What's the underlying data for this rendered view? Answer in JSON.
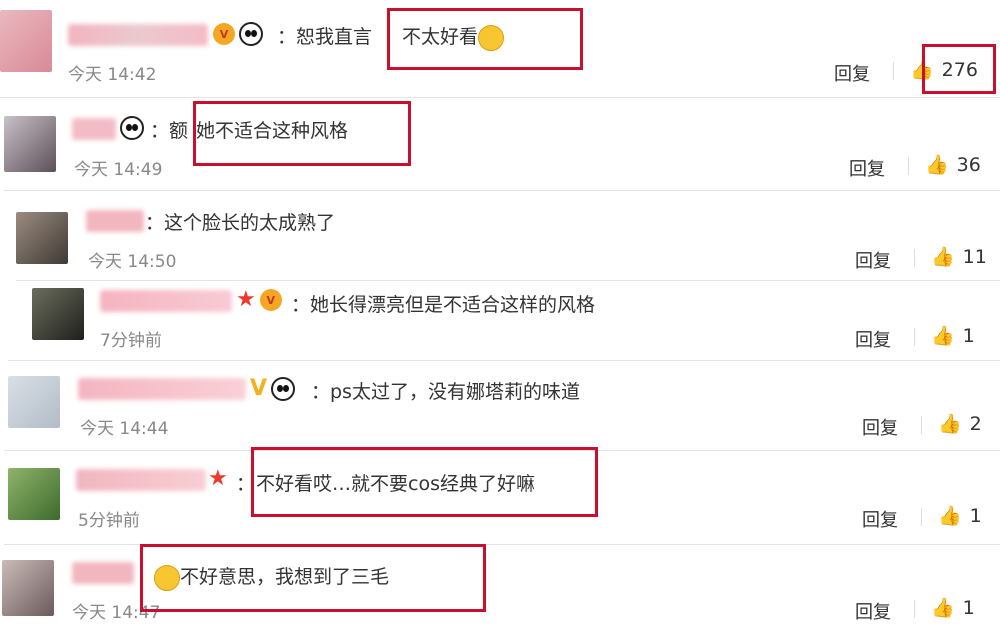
{
  "comments": [
    {
      "username_blurred": "用户昵称",
      "text": "：恕我直言",
      "quote": "不太好看",
      "time": "今天 14:42",
      "reply": "回复",
      "likes": "276"
    },
    {
      "text": "：额",
      "quote": "她不适合这种风格",
      "time": "今天 14:49",
      "reply": "回复",
      "likes": "36"
    },
    {
      "text": "：这个脸长的太成熟了",
      "time": "今天 14:50",
      "reply": "回复",
      "likes": "11"
    },
    {
      "username_blurred": "BABY CHUPIN",
      "text": "：她长得漂亮但是不适合这样的风格",
      "time": "7分钟前",
      "reply": "回复",
      "likes": "1"
    },
    {
      "text": "：ps太过了，没有娜塔莉的味道",
      "time": "今天 14:44",
      "reply": "回复",
      "likes": "2"
    },
    {
      "text": "：",
      "quote": "不好看哎…就不要cos经典了好嘛",
      "time": "5分钟前",
      "reply": "回复",
      "likes": "1"
    },
    {
      "text": "",
      "quote": "不好意思，我想到了三毛",
      "time": "今天 14:47",
      "reply": "回复",
      "likes": "1"
    }
  ],
  "icons": {
    "like": "thumbs-up-icon",
    "emoji_glasses": "glasses-face-icon",
    "emoji_cry": "crying-laugh-icon"
  },
  "colors": {
    "highlight": "#c8102e",
    "text": "#333333",
    "time": "#888888"
  }
}
